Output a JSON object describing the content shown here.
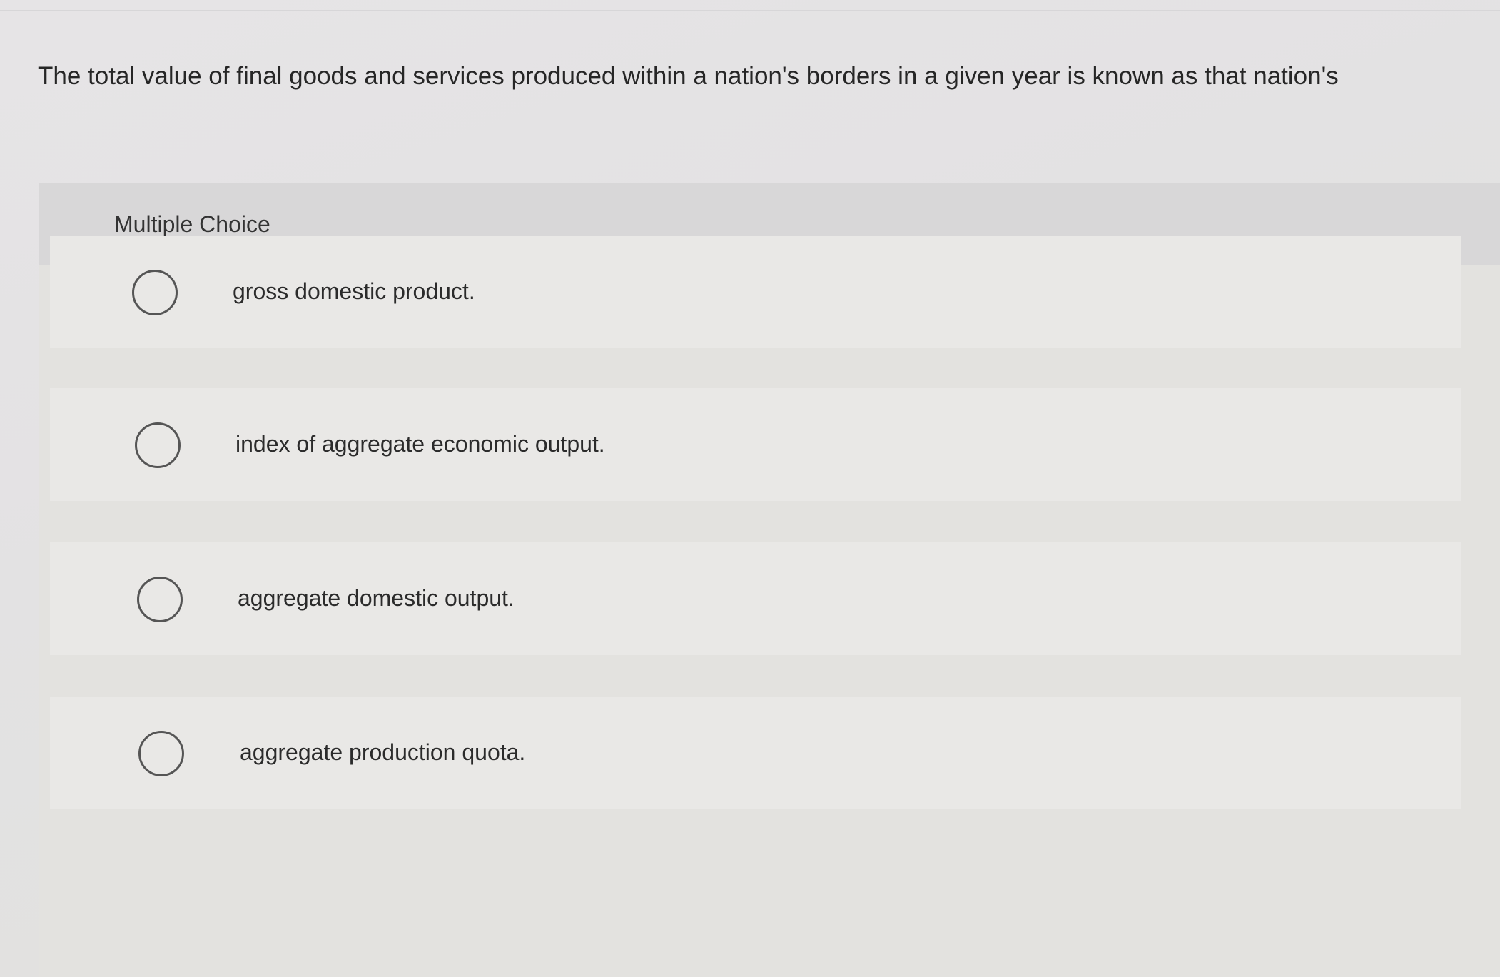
{
  "question": {
    "text": "The total value of final goods and services produced within a nation's borders in a given year is known as that nation's"
  },
  "panel": {
    "label": "Multiple Choice"
  },
  "options": [
    {
      "label": "gross domestic product.",
      "selected": false
    },
    {
      "label": "index of aggregate economic output.",
      "selected": false
    },
    {
      "label": "aggregate domestic output.",
      "selected": false
    },
    {
      "label": "aggregate production quota.",
      "selected": false
    }
  ],
  "icons": {
    "radio": "radio-unselected-icon"
  }
}
